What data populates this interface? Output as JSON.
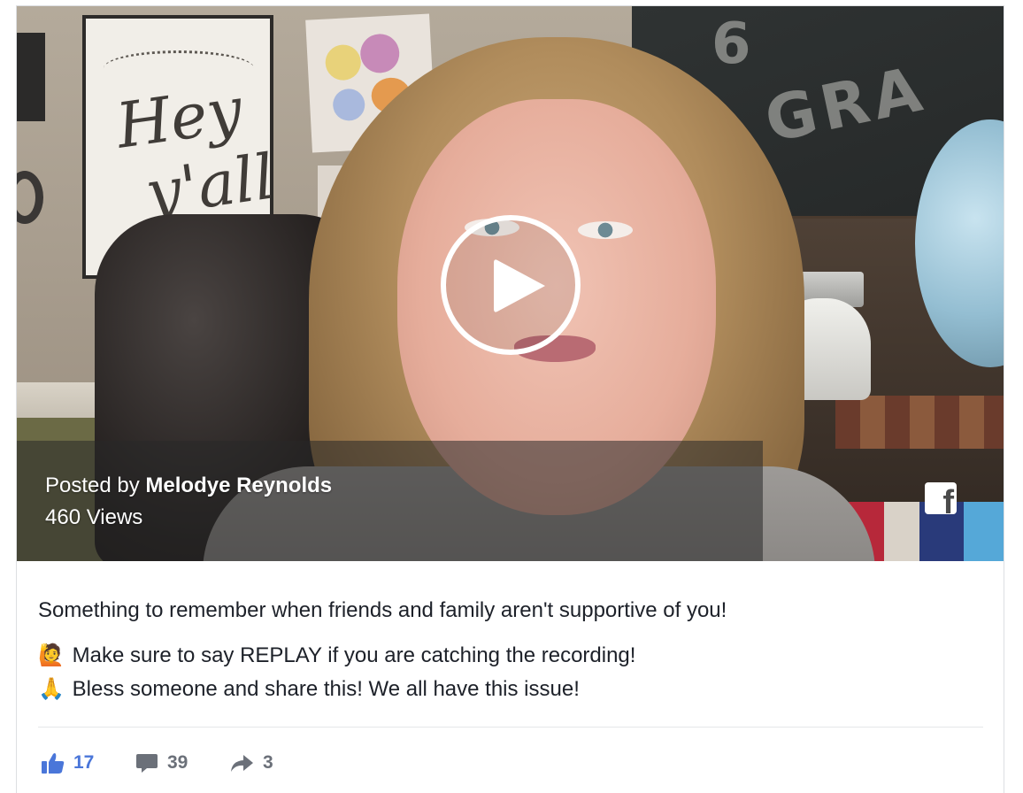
{
  "video": {
    "posted_prefix": "Posted by",
    "author": "Melodye Reynolds",
    "views": "460 Views",
    "play_icon": "play-icon",
    "platform_icon": "facebook-logo-icon",
    "platform_glyph": "f"
  },
  "post": {
    "message": "Something to remember when friends and family aren't supportive of you!",
    "lines": [
      {
        "emoji": "🙋",
        "emoji_name": "raising-hand-emoji",
        "text": "Make sure to say REPLAY if you are catching the recording!"
      },
      {
        "emoji": "🙏",
        "emoji_name": "folded-hands-emoji",
        "text": "Bless someone and share this! We all have this issue!"
      }
    ]
  },
  "actions": {
    "likes": "17",
    "comments": "39",
    "shares": "3",
    "like_icon": "thumbs-up-icon",
    "comment_icon": "comment-bubble-icon",
    "share_icon": "share-arrow-icon"
  },
  "colors": {
    "accent": "#4a76d9",
    "muted": "#6b7079",
    "text": "#1d2129"
  }
}
